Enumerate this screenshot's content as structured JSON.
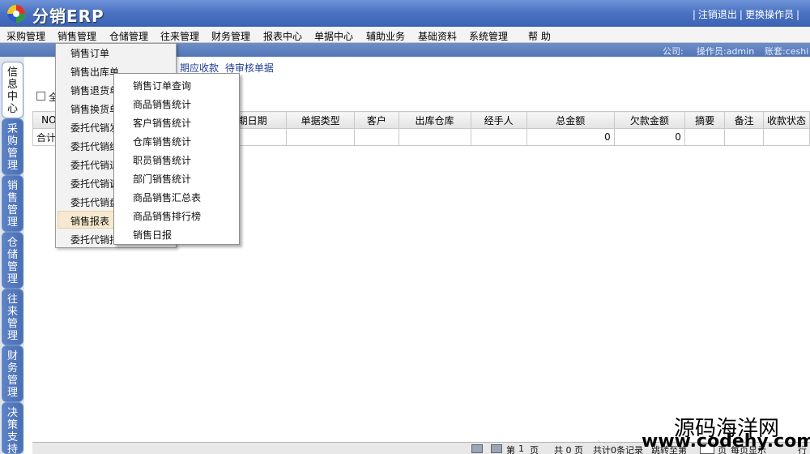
{
  "app": {
    "title": "分销ERP",
    "logo_icon": "colorful-ring-logo"
  },
  "top_links": {
    "logout": "注销退出",
    "switch_operator": "更换操作员"
  },
  "menu": [
    "采购管理",
    "销售管理",
    "仓储管理",
    "往来管理",
    "财务管理",
    "报表中心",
    "单据中心",
    "辅助业务",
    "基础资料",
    "系统管理",
    "帮 助"
  ],
  "status": {
    "company_label": "公司:",
    "operator_label": "操作员:admin",
    "account_label": "账套:ceshi"
  },
  "left_tabs": [
    {
      "label": "信息中心",
      "active": true
    },
    {
      "label": "采购管理",
      "active": false
    },
    {
      "label": "销售管理",
      "active": false
    },
    {
      "label": "仓储管理",
      "active": false
    },
    {
      "label": "往来管理",
      "active": false
    },
    {
      "label": "财务管理",
      "active": false
    },
    {
      "label": "决策支持",
      "active": false
    }
  ],
  "content_links": {
    "due_receivable": "期应收款",
    "pending_docs": "待审核单据"
  },
  "checkbox_label": "全",
  "table": {
    "headers": [
      "NO",
      "",
      "期日期",
      "单据类型",
      "客户",
      "出库仓库",
      "经手人",
      "总金额",
      "欠款金额",
      "摘要",
      "备注",
      "收款状态"
    ],
    "summary_row": {
      "label": "合计",
      "total_amount": "0",
      "debt_amount": "0"
    }
  },
  "sales_menu": {
    "items": [
      "销售订单",
      "销售出库单",
      "销售退货单",
      "销售换货单",
      "委托代销发货单",
      "委托代销结算单",
      "委托代销退货单",
      "委托代销调价单",
      "委托代销盘点单",
      "销售报表",
      "委托代销报表"
    ],
    "highlighted": "销售报表"
  },
  "report_submenu": [
    "销售订单查询",
    "商品销售统计",
    "客户销售统计",
    "仓库销售统计",
    "职员销售统计",
    "部门销售统计",
    "商品销售汇总表",
    "商品销售排行榜",
    "销售日报"
  ],
  "pager": {
    "page_prefix": "第",
    "page_value": "1",
    "page_suffix": "页",
    "total_pages": "共 0 页",
    "total_records": "共计0条记录",
    "jump_label": "跳转至第",
    "jump_suffix": "页",
    "per_page_label": "每页显示",
    "rows_suffix": "行"
  },
  "watermark": {
    "cn": "源码海洋网",
    "url": "www.codehy.com"
  }
}
